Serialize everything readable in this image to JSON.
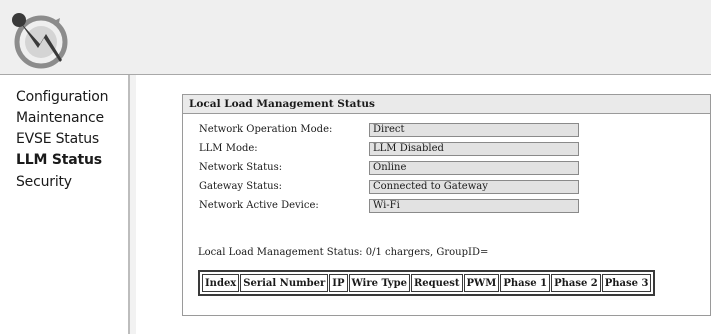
{
  "brand": {
    "logo_icon": "plug-bolt-logo-icon"
  },
  "sidebar": {
    "items": [
      {
        "label": "Configuration",
        "active": false
      },
      {
        "label": "Maintenance",
        "active": false
      },
      {
        "label": "EVSE Status",
        "active": false
      },
      {
        "label": "LLM Status",
        "active": true
      },
      {
        "label": "Security",
        "active": false
      }
    ]
  },
  "panel": {
    "title": "Local Load Management Status",
    "rows": [
      {
        "label": "Network Operation Mode:",
        "value": "Direct"
      },
      {
        "label": "LLM Mode:",
        "value": "LLM Disabled"
      },
      {
        "label": "Network Status:",
        "value": "Online"
      },
      {
        "label": "Gateway Status:",
        "value": "Connected to Gateway"
      },
      {
        "label": "Network Active Device:",
        "value": "Wi-Fi"
      }
    ],
    "summary": "Local Load Management Status: 0/1 chargers, GroupID=",
    "table": {
      "headers": [
        "Index",
        "Serial Number",
        "IP",
        "Wire Type",
        "Request",
        "PWM",
        "Phase 1",
        "Phase 2",
        "Phase 3"
      ]
    }
  },
  "colors": {
    "header_bg": "#efefef",
    "panel_title_bg": "#eaeaea",
    "value_field_bg": "#e2e2e2",
    "logo_grey": "#8c8c8c",
    "logo_dark": "#3a3a3a"
  }
}
